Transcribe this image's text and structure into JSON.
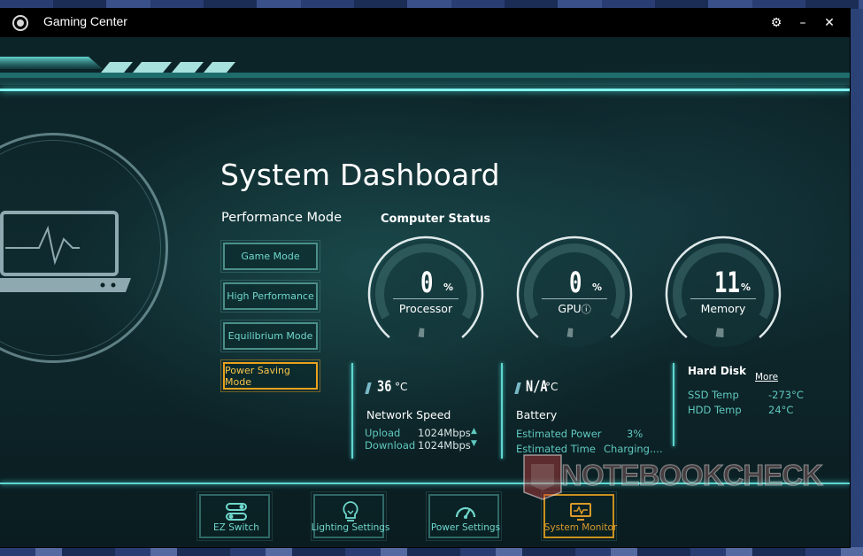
{
  "window": {
    "title": "Gaming Center"
  },
  "titlebar": {
    "settings_icon": "gear-icon",
    "minimize_icon": "minimize-icon",
    "close_icon": "close-icon",
    "minimize_glyph": "–",
    "close_glyph": "✕",
    "settings_glyph": "⚙"
  },
  "dashboard": {
    "title": "System Dashboard"
  },
  "performance": {
    "heading": "Performance Mode",
    "modes": [
      {
        "label": "Game Mode",
        "active": false
      },
      {
        "label": "High Performance",
        "active": false
      },
      {
        "label": "Equilibrium Mode",
        "active": false
      },
      {
        "label": "Power Saving Mode",
        "active": true
      }
    ]
  },
  "status": {
    "heading": "Computer Status",
    "gauges": [
      {
        "name": "Processor",
        "value": "0",
        "unit": "%",
        "percent": 0
      },
      {
        "name": "GPU",
        "value": "0",
        "unit": "%",
        "percent": 0,
        "info_icon": "info-icon",
        "info_glyph": "ⓘ"
      },
      {
        "name": "Memory",
        "value": "11",
        "unit": "%",
        "percent": 11
      }
    ]
  },
  "network": {
    "temp_value": "36",
    "temp_unit": "°C",
    "title": "Network Speed",
    "upload_label": "Upload",
    "upload_value": "1024Mbps",
    "download_label": "Download",
    "download_value": "1024Mbps"
  },
  "battery": {
    "temp_value": "N/A",
    "temp_unit": "°C",
    "title": "Battery",
    "est_power_label": "Estimated Power",
    "est_power_value": "3%",
    "est_time_label": "Estimated Time",
    "est_time_value": "Charging...."
  },
  "disk": {
    "title": "Hard Disk",
    "more_label": "More",
    "ssd_label": "SSD Temp",
    "ssd_value": "-273°C",
    "hdd_label": "HDD Temp",
    "hdd_value": "24°C"
  },
  "nav": [
    {
      "label": "EZ Switch",
      "icon": "toggle-switch-icon",
      "active": false
    },
    {
      "label": "Lighting Settings",
      "icon": "light-bulb-icon",
      "active": false
    },
    {
      "label": "Power Settings",
      "icon": "speedometer-icon",
      "active": false
    },
    {
      "label": "System Monitor",
      "icon": "monitor-icon",
      "active": true
    }
  ],
  "watermark": {
    "text": "NOTEBOOKCHECK"
  },
  "colors": {
    "accent": "#5fd6d0",
    "active": "#e9a21c",
    "background": "#0d2226"
  }
}
